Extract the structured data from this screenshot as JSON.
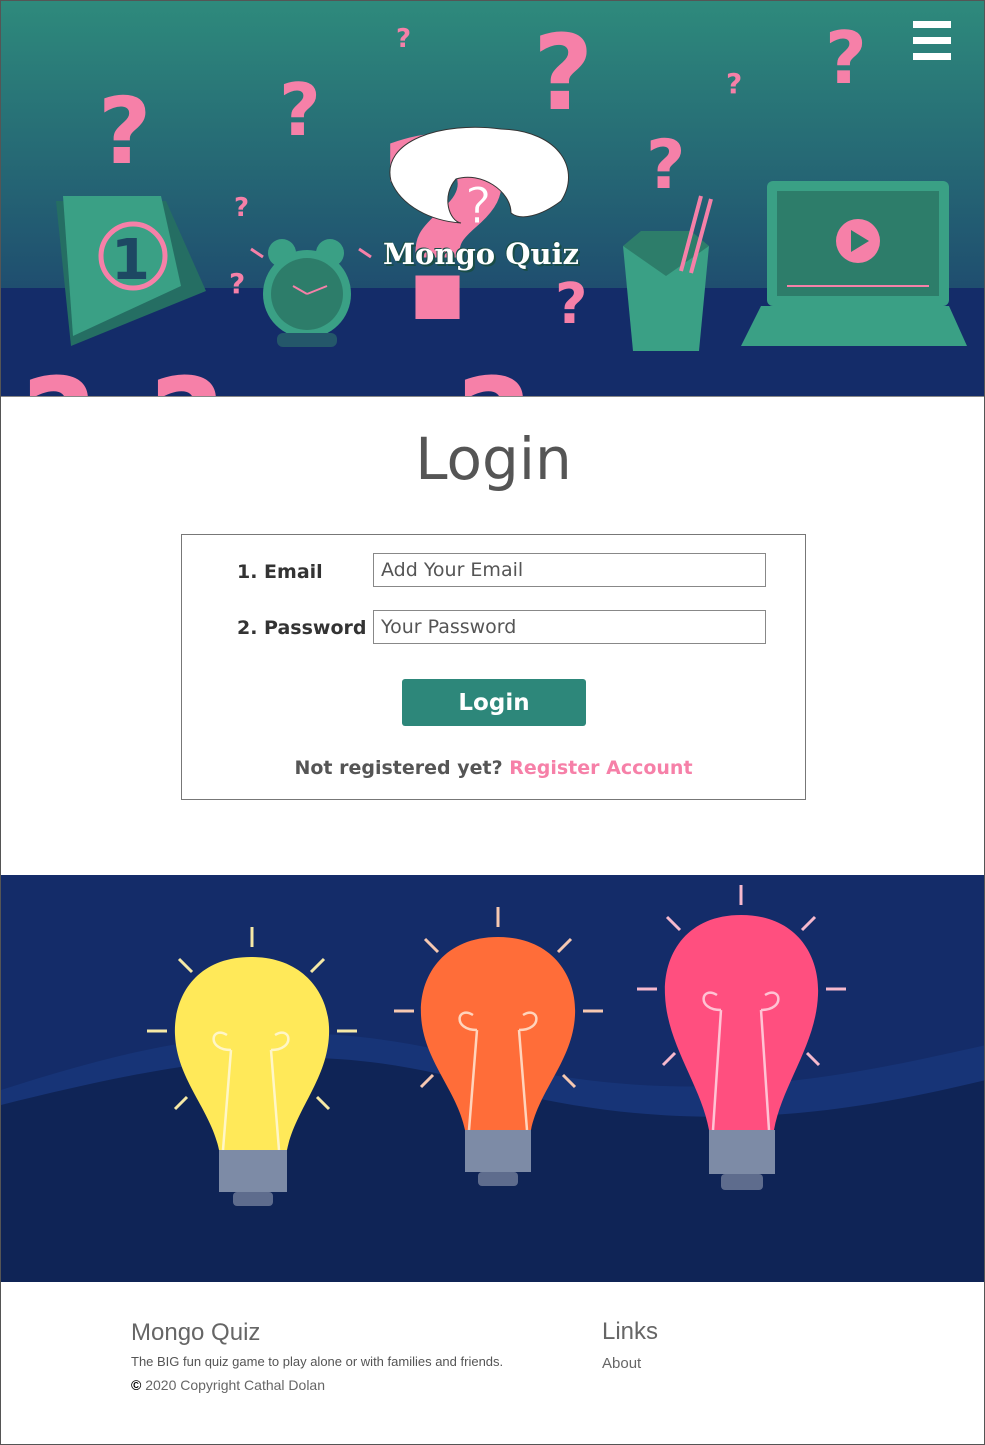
{
  "header": {
    "brand": "Mongo Quiz",
    "menu_icon": "hamburger-menu-icon"
  },
  "login": {
    "title": "Login",
    "email_label": "1. Email",
    "email_placeholder": "Add Your Email",
    "password_label": "2. Password",
    "password_placeholder": "Your Password",
    "submit_label": "Login",
    "not_registered": "Not registered yet?",
    "register_link": "Register Account"
  },
  "footer": {
    "title": "Mongo Quiz",
    "description": "The BIG fun quiz game to play alone or with families and friends.",
    "copyright_symbol": "©",
    "copyright": " 2020 Copyright Cathal Dolan",
    "links_title": "Links",
    "about_link": "About"
  },
  "colors": {
    "accent_teal": "#2d877a",
    "accent_pink": "#f680a8",
    "navy": "#142c69"
  }
}
